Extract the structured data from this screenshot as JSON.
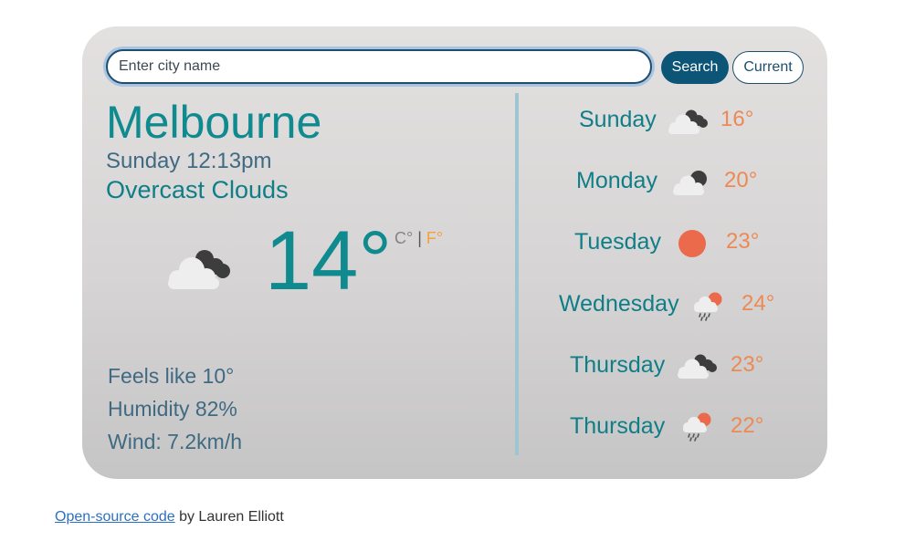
{
  "search": {
    "placeholder": "Enter city name",
    "value": ""
  },
  "buttons": {
    "search_label": "Search",
    "current_label": "Current"
  },
  "current": {
    "city": "Melbourne",
    "datetime": "Sunday 12:13pm",
    "description": "Overcast Clouds",
    "icon": "broken-clouds-icon",
    "temperature": "14°",
    "unit_c": "C°",
    "unit_sep": "|",
    "unit_f": "F°",
    "feels_like": "Feels like 10°",
    "humidity": "Humidity 82%",
    "wind": "Wind: 7.2km/h"
  },
  "forecast": [
    {
      "day": "Sunday",
      "temp": "16°",
      "icon": "broken-clouds-icon"
    },
    {
      "day": "Monday",
      "temp": "20°",
      "icon": "scattered-clouds-icon"
    },
    {
      "day": "Tuesday",
      "temp": "23°",
      "icon": "sun-icon"
    },
    {
      "day": "Wednesday",
      "temp": "24°",
      "icon": "sun-rain-icon"
    },
    {
      "day": "Thursday",
      "temp": "23°",
      "icon": "broken-clouds-icon"
    },
    {
      "day": "Thursday",
      "temp": "22°",
      "icon": "sun-rain-icon"
    }
  ],
  "footer": {
    "link_text": "Open-source code",
    "author_text": " by Lauren Elliott"
  },
  "colors": {
    "accent": "#0f8a8f",
    "button": "#0d5576",
    "temp": "#ec8a55",
    "unit_active": "#f4a33b",
    "sun": "#ec6a4c"
  }
}
